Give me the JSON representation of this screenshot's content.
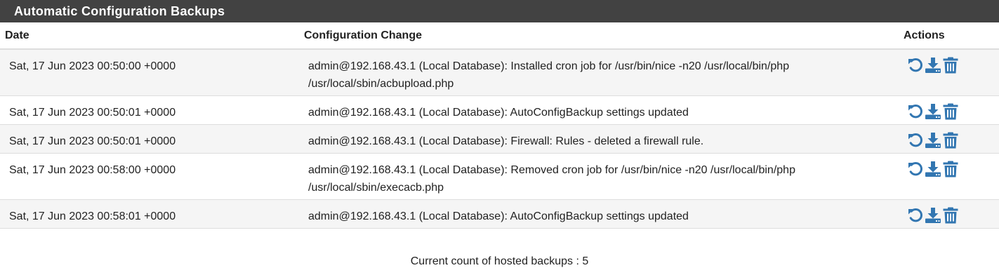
{
  "panel": {
    "title": "Automatic Configuration Backups"
  },
  "table": {
    "headers": {
      "date": "Date",
      "change": "Configuration Change",
      "actions": "Actions"
    },
    "rows": [
      {
        "date": "Sat, 17 Jun 2023 00:50:00 +0000",
        "change_line1": "admin@192.168.43.1 (Local Database): Installed cron job for /usr/bin/nice -n20 /usr/local/bin/php",
        "change_line2": "/usr/local/sbin/acbupload.php"
      },
      {
        "date": "Sat, 17 Jun 2023 00:50:01 +0000",
        "change_line1": "admin@192.168.43.1 (Local Database): AutoConfigBackup settings updated",
        "change_line2": ""
      },
      {
        "date": "Sat, 17 Jun 2023 00:50:01 +0000",
        "change_line1": "admin@192.168.43.1 (Local Database): Firewall: Rules - deleted a firewall rule.",
        "change_line2": ""
      },
      {
        "date": "Sat, 17 Jun 2023 00:58:00 +0000",
        "change_line1": "admin@192.168.43.1 (Local Database): Removed cron job for /usr/bin/nice -n20 /usr/local/bin/php",
        "change_line2": "/usr/local/sbin/execacb.php"
      },
      {
        "date": "Sat, 17 Jun 2023 00:58:01 +0000",
        "change_line1": "admin@192.168.43.1 (Local Database): AutoConfigBackup settings updated",
        "change_line2": ""
      }
    ],
    "action_icons": [
      "restore-icon",
      "download-icon",
      "trash-icon"
    ]
  },
  "footer": {
    "count_text": "Current count of hosted backups : 5"
  },
  "colors": {
    "header_bg": "#424242",
    "icon": "#3276b1",
    "row_stripe": "#f5f5f5"
  }
}
